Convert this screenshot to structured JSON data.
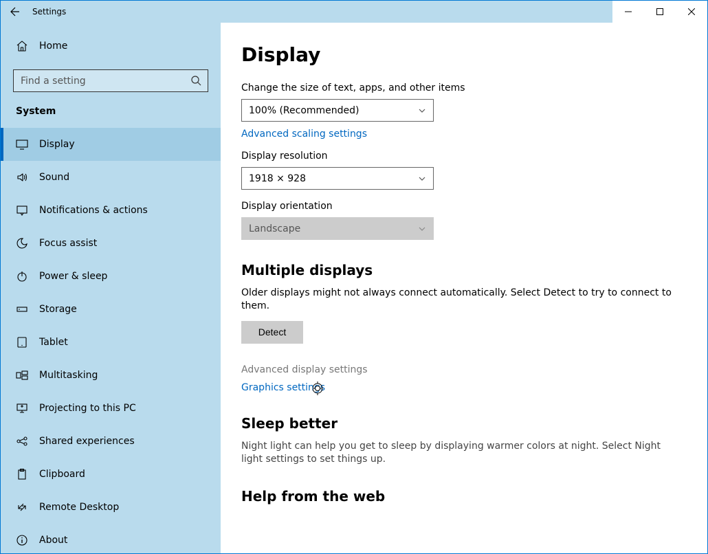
{
  "appTitle": "Settings",
  "search": {
    "placeholder": "Find a setting"
  },
  "homeLabel": "Home",
  "categoryLabel": "System",
  "nav": [
    {
      "label": "Display"
    },
    {
      "label": "Sound"
    },
    {
      "label": "Notifications & actions"
    },
    {
      "label": "Focus assist"
    },
    {
      "label": "Power & sleep"
    },
    {
      "label": "Storage"
    },
    {
      "label": "Tablet"
    },
    {
      "label": "Multitasking"
    },
    {
      "label": "Projecting to this PC"
    },
    {
      "label": "Shared experiences"
    },
    {
      "label": "Clipboard"
    },
    {
      "label": "Remote Desktop"
    },
    {
      "label": "About"
    }
  ],
  "page": {
    "title": "Display",
    "scaleLabel": "Change the size of text, apps, and other items",
    "scaleValue": "100% (Recommended)",
    "advScaling": "Advanced scaling settings",
    "resLabel": "Display resolution",
    "resValue": "1918 × 928",
    "orientLabel": "Display orientation",
    "orientValue": "Landscape",
    "multi": {
      "heading": "Multiple displays",
      "desc": "Older displays might not always connect automatically. Select Detect to try to connect to them.",
      "detect": "Detect"
    },
    "advDisplay": "Advanced display settings",
    "graphics": "Graphics settings",
    "sleep": {
      "heading": "Sleep better",
      "desc": "Night light can help you get to sleep by displaying warmer colors at night. Select Night light settings to set things up."
    },
    "helpHeading": "Help from the web"
  }
}
